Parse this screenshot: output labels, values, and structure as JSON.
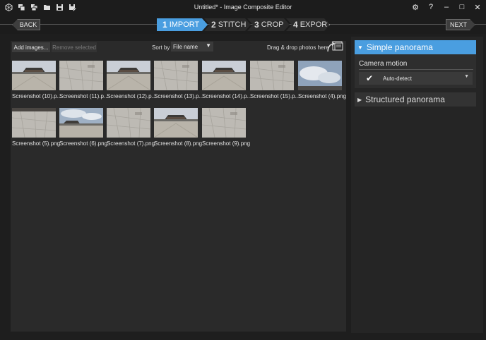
{
  "window": {
    "title": "Untitled* - Image Composite Editor"
  },
  "titlebar_icons": [
    "app-icon",
    "new-project-icon",
    "open-images-icon",
    "open-folder-icon",
    "save-icon",
    "save-as-icon"
  ],
  "window_controls": {
    "settings_glyph": "⚙",
    "help_glyph": "?",
    "minimize_glyph": "–",
    "maximize_glyph": "□",
    "close_glyph": "✕"
  },
  "navigation": {
    "back_label": "BACK",
    "next_label": "NEXT",
    "steps": [
      {
        "num": "1",
        "label": "IMPORT",
        "active": true
      },
      {
        "num": "2",
        "label": "STITCH",
        "active": false
      },
      {
        "num": "3",
        "label": "CROP",
        "active": false
      },
      {
        "num": "4",
        "label": "EXPORT",
        "active": false
      }
    ]
  },
  "toolbar": {
    "add_label": "Add images...",
    "remove_label": "Remove selected",
    "sort_label": "Sort by",
    "sort_value": "File name",
    "dragdrop_label": "Drag & drop photos here"
  },
  "thumbnails": [
    {
      "caption": "Screenshot (10).p...",
      "kind": "building"
    },
    {
      "caption": "Screenshot (11).p...",
      "kind": "ground"
    },
    {
      "caption": "Screenshot (12).p...",
      "kind": "building"
    },
    {
      "caption": "Screenshot (13).p...",
      "kind": "ground"
    },
    {
      "caption": "Screenshot (14).p...",
      "kind": "building"
    },
    {
      "caption": "Screenshot (15).p...",
      "kind": "ground"
    },
    {
      "caption": "Screenshot (4).png",
      "kind": "sky"
    },
    {
      "caption": "Screenshot (5).png",
      "kind": "ground-top"
    },
    {
      "caption": "Screenshot (6).png",
      "kind": "building-sky"
    },
    {
      "caption": "Screenshot (7).png",
      "kind": "ground"
    },
    {
      "caption": "Screenshot (8).png",
      "kind": "building"
    },
    {
      "caption": "Screenshot (9).png",
      "kind": "ground"
    }
  ],
  "panel": {
    "simple_label": "Simple panorama",
    "camera_motion_label": "Camera motion",
    "camera_motion_value": "Auto-detect",
    "structured_label": "Structured panorama"
  },
  "colors": {
    "accent": "#4a9ee0",
    "background": "#1e1e1e",
    "panel": "#2a2a2a"
  }
}
